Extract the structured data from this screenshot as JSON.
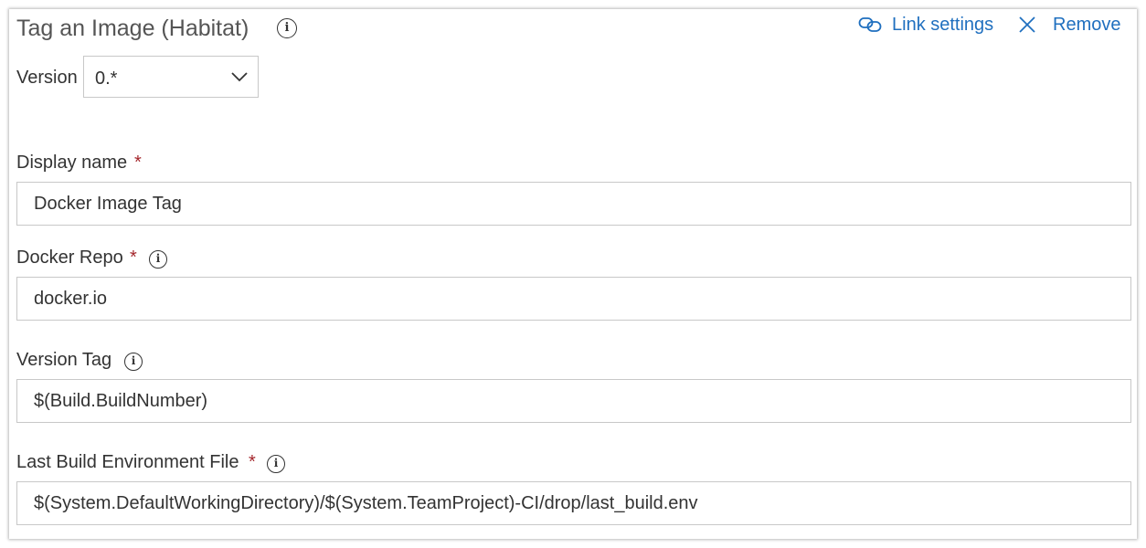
{
  "header": {
    "title": "Tag an Image (Habitat)",
    "link_settings_label": "Link settings",
    "remove_label": "Remove"
  },
  "version": {
    "label": "Version",
    "selected": "0.*"
  },
  "fields": {
    "display_name": {
      "label": "Display name",
      "required_mark": "*",
      "value": "Docker Image Tag"
    },
    "docker_repo": {
      "label": "Docker Repo",
      "required_mark": "*",
      "value": "docker.io"
    },
    "version_tag": {
      "label": "Version Tag",
      "value": "$(Build.BuildNumber)"
    },
    "last_build_env_file": {
      "label": "Last Build Environment File",
      "required_mark": "*",
      "value": "$(System.DefaultWorkingDirectory)/$(System.TeamProject)-CI/drop/last_build.env"
    }
  },
  "icons": {
    "info": "info-icon",
    "link": "link-icon",
    "close": "close-icon",
    "chevron": "chevron-down-icon",
    "info_glyph": "i"
  },
  "colors": {
    "accent": "#1f6fbf",
    "required": "#a4262c",
    "text": "#333333",
    "title": "#555555",
    "border": "#c8c8c8"
  }
}
